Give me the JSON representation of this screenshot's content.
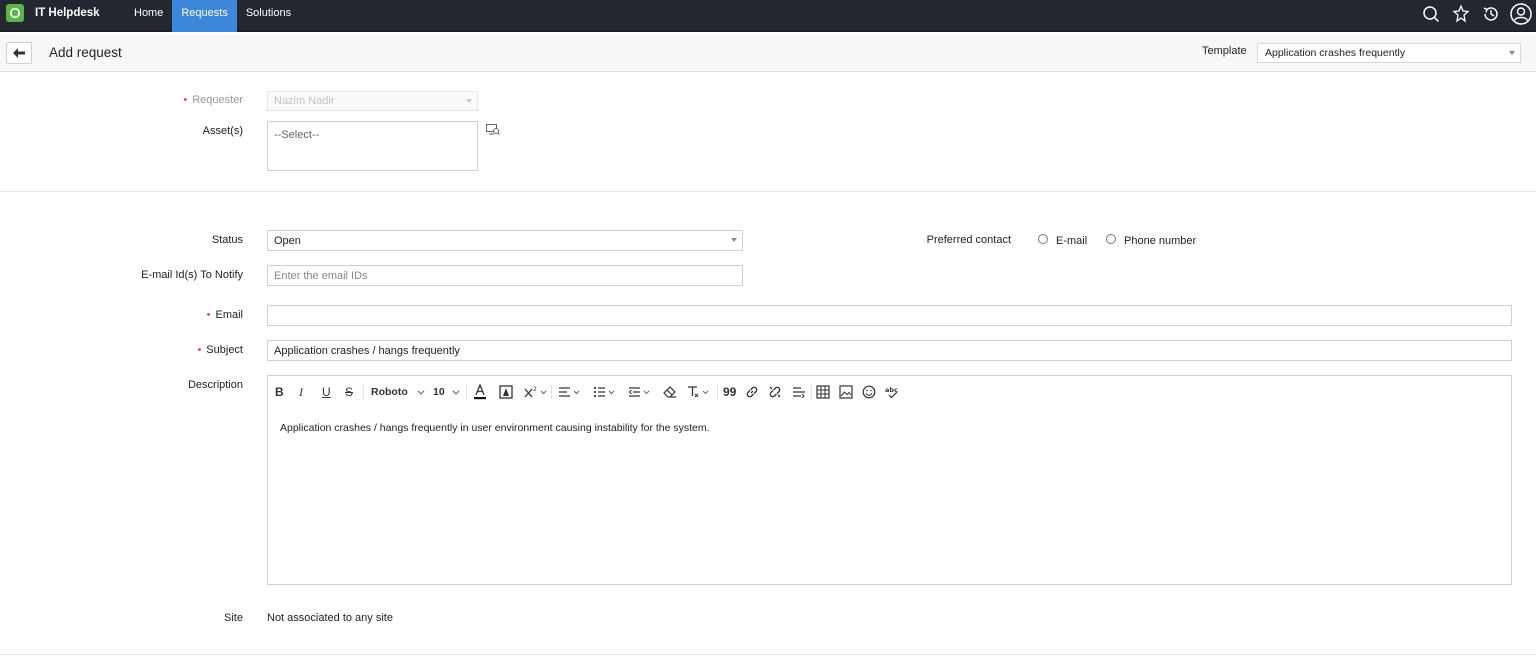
{
  "app": {
    "title": "IT Helpdesk"
  },
  "nav": [
    {
      "label": "Home",
      "active": false
    },
    {
      "label": "Requests",
      "active": true
    },
    {
      "label": "Solutions",
      "active": false
    }
  ],
  "header": {
    "title": "Add request",
    "template_label": "Template",
    "template_value": "Application crashes frequently"
  },
  "form": {
    "requester": {
      "label": "Requester",
      "value": "Nazim Nadir",
      "required": true
    },
    "assets": {
      "label": "Asset(s)",
      "placeholder": "--Select--"
    },
    "status": {
      "label": "Status",
      "value": "Open"
    },
    "preferred_contact": {
      "label": "Preferred contact",
      "options": [
        "E-mail",
        "Phone number"
      ]
    },
    "notify": {
      "label": "E-mail Id(s) To Notify",
      "placeholder": "Enter the email IDs"
    },
    "email": {
      "label": "Email",
      "value": "",
      "required": true
    },
    "subject": {
      "label": "Subject",
      "value": "Application crashes / hangs frequently",
      "required": true
    },
    "description": {
      "label": "Description",
      "font": "Roboto",
      "font_size": "10",
      "text": "Application crashes / hangs frequently in user environment causing instability for the system."
    },
    "site": {
      "label": "Site",
      "value": "Not associated to any site"
    }
  },
  "colors": {
    "topbar": "#23272f",
    "active_nav": "#3d87d9",
    "logo": "#5bb64a",
    "required": "#e05252"
  }
}
